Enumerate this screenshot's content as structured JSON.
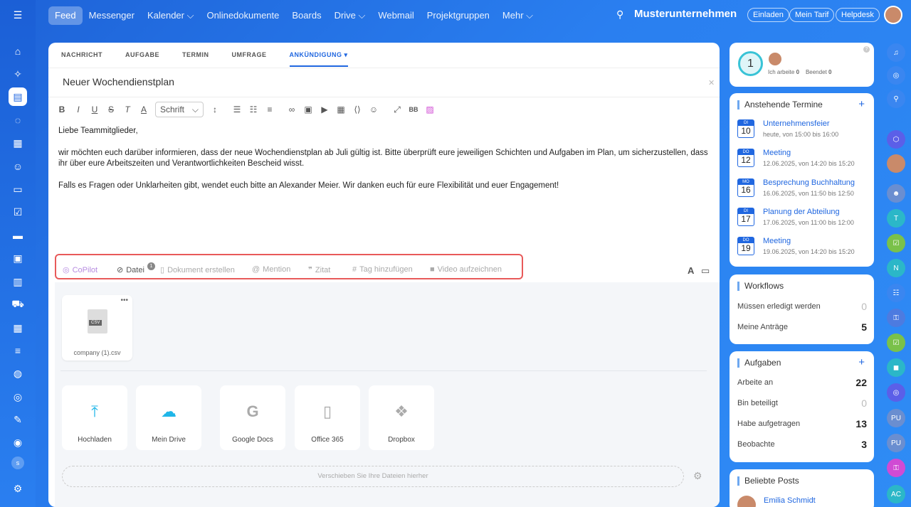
{
  "topnav": {
    "items": [
      "Feed",
      "Messenger",
      "Kalender ⌵",
      "Onlinedokumente",
      "Boards",
      "Drive ⌵",
      "Webmail",
      "Projektgruppen",
      "Mehr ⌵"
    ],
    "company": "Musterunternehmen",
    "buttons": [
      "Einladen",
      "Mein Tarif",
      "Helpdesk"
    ]
  },
  "editor": {
    "tabs": [
      "NACHRICHT",
      "AUFGABE",
      "TERMIN",
      "UMFRAGE",
      "ANKÜNDIGUNG ▾"
    ],
    "title": "Neuer Wochendienstplan",
    "font_select": "Schrift",
    "paragraphs": [
      "Liebe Teammitglieder,",
      "wir möchten euch darüber informieren, dass der neue Wochendienstplan ab Juli gültig ist. Bitte überprüft eure jeweiligen Schichten und Aufgaben im Plan, um sicherzustellen, dass ihr über eure Arbeitszeiten und Verantwortlichkeiten Bescheid wisst.",
      "Falls es Fragen oder Unklarheiten gibt, wendet euch bitte an Alexander Meier. Wir danken euch für eure Flexibilität und euer Engagement!"
    ],
    "attach": {
      "copilot": "CoPilot",
      "datei": "Datei",
      "datei_count": "1",
      "dokument": "Dokument erstellen",
      "mention": "Mention",
      "zitat": "Zitat",
      "tag": "Tag hinzufügen",
      "video": "Video aufzeichnen"
    },
    "file": {
      "name": "company (1).csv",
      "type": "CSV"
    },
    "sources": [
      "Hochladen",
      "Mein Drive",
      "Google Docs",
      "Office 365",
      "Dropbox"
    ],
    "dropzone": "Verschieben Sie Ihre Dateien hierher"
  },
  "status": {
    "count": "1",
    "working": "Ich arbeite",
    "working_n": "0",
    "done": "Beendet",
    "done_n": "0"
  },
  "termine": {
    "title": "Anstehende Termine",
    "events": [
      {
        "m": "DI",
        "d": "10",
        "title": "Unternehmensfeier",
        "time": "heute, von 15:00 bis 16:00"
      },
      {
        "m": "DO",
        "d": "12",
        "title": "Meeting",
        "time": "12.06.2025, von 14:20 bis 15:20"
      },
      {
        "m": "MO",
        "d": "16",
        "title": "Besprechung Buchhaltung",
        "time": "16.06.2025, von 11:50 bis 12:50"
      },
      {
        "m": "DI",
        "d": "17",
        "title": "Planung der Abteilung",
        "time": "17.06.2025, von 11:00 bis 12:00"
      },
      {
        "m": "DO",
        "d": "19",
        "title": "Meeting",
        "time": "19.06.2025, von 14:20 bis 15:20"
      }
    ]
  },
  "workflows": {
    "title": "Workflows",
    "rows": [
      {
        "label": "Müssen erledigt werden",
        "value": "0"
      },
      {
        "label": "Meine Anträge",
        "value": "5"
      }
    ]
  },
  "aufgaben": {
    "title": "Aufgaben",
    "rows": [
      {
        "label": "Arbeite an",
        "value": "22"
      },
      {
        "label": "Bin beteiligt",
        "value": "0"
      },
      {
        "label": "Habe aufgetragen",
        "value": "13"
      },
      {
        "label": "Beobachte",
        "value": "3"
      }
    ]
  },
  "posts": {
    "title": "Beliebte Posts",
    "author": "Emilia Schmidt"
  },
  "rightbar": {
    "t": "T",
    "n": "N",
    "pu1": "PU",
    "pu2": "PU",
    "ac": "AC"
  },
  "leftbar": {
    "s": "s"
  }
}
